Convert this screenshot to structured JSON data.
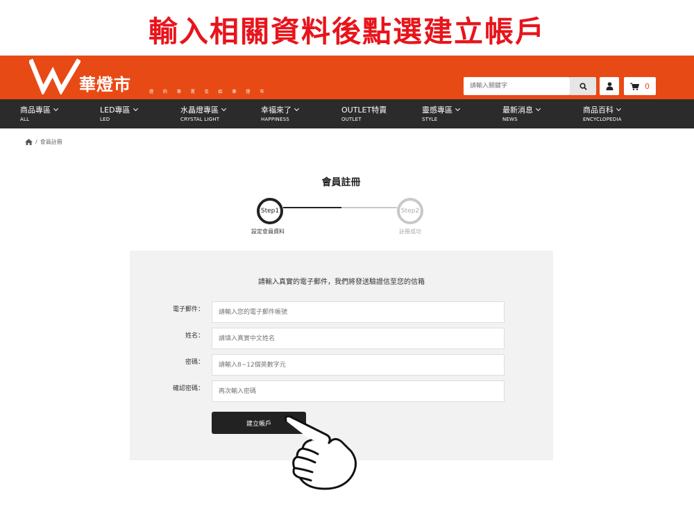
{
  "instruction": "輸入相關資料後點選建立帳戶",
  "header": {
    "logo_text": "華燈市",
    "slogan": "燈 的 專 賣 交 給 華 燈 市",
    "search_placeholder": "請輸入關鍵字",
    "cart_count": "0"
  },
  "nav": {
    "items": [
      {
        "label": "商品專區",
        "sub": "ALL"
      },
      {
        "label": "LED專區",
        "sub": "LED"
      },
      {
        "label": "水晶燈專區",
        "sub": "CRYSTAL LIGHT"
      },
      {
        "label": "幸福來了",
        "sub": "HAPPINESS"
      },
      {
        "label": "OUTLET特賣",
        "sub": "OUTLET"
      },
      {
        "label": "靈感專區",
        "sub": "STYLE"
      },
      {
        "label": "最新消息",
        "sub": "NEWS"
      },
      {
        "label": "商品百科",
        "sub": "ENCYCLOPEDIA"
      }
    ]
  },
  "breadcrumb": {
    "current": "會員註冊",
    "separator": "/"
  },
  "page_title": "會員註冊",
  "stepper": {
    "step1": {
      "circle": "Step1",
      "label": "設定會員資料"
    },
    "step2": {
      "circle": "Step2",
      "label": "註冊成功"
    }
  },
  "form": {
    "intro": "請輸入真實的電子郵件，我們將發送驗證信至您的信箱",
    "email": {
      "label": "電子郵件：",
      "placeholder": "請輸入您的電子郵件帳號"
    },
    "name": {
      "label": "姓名：",
      "placeholder": "請填入真實中文姓名"
    },
    "password": {
      "label": "密碼：",
      "placeholder": "請輸入8~12個英數字元"
    },
    "confirm": {
      "label": "確認密碼：",
      "placeholder": "再次輸入密碼"
    },
    "submit_label": "建立帳戶"
  },
  "colors": {
    "brand": "#e84a16",
    "nav_bg": "#2b2b2b",
    "instruction": "#e8141c"
  }
}
